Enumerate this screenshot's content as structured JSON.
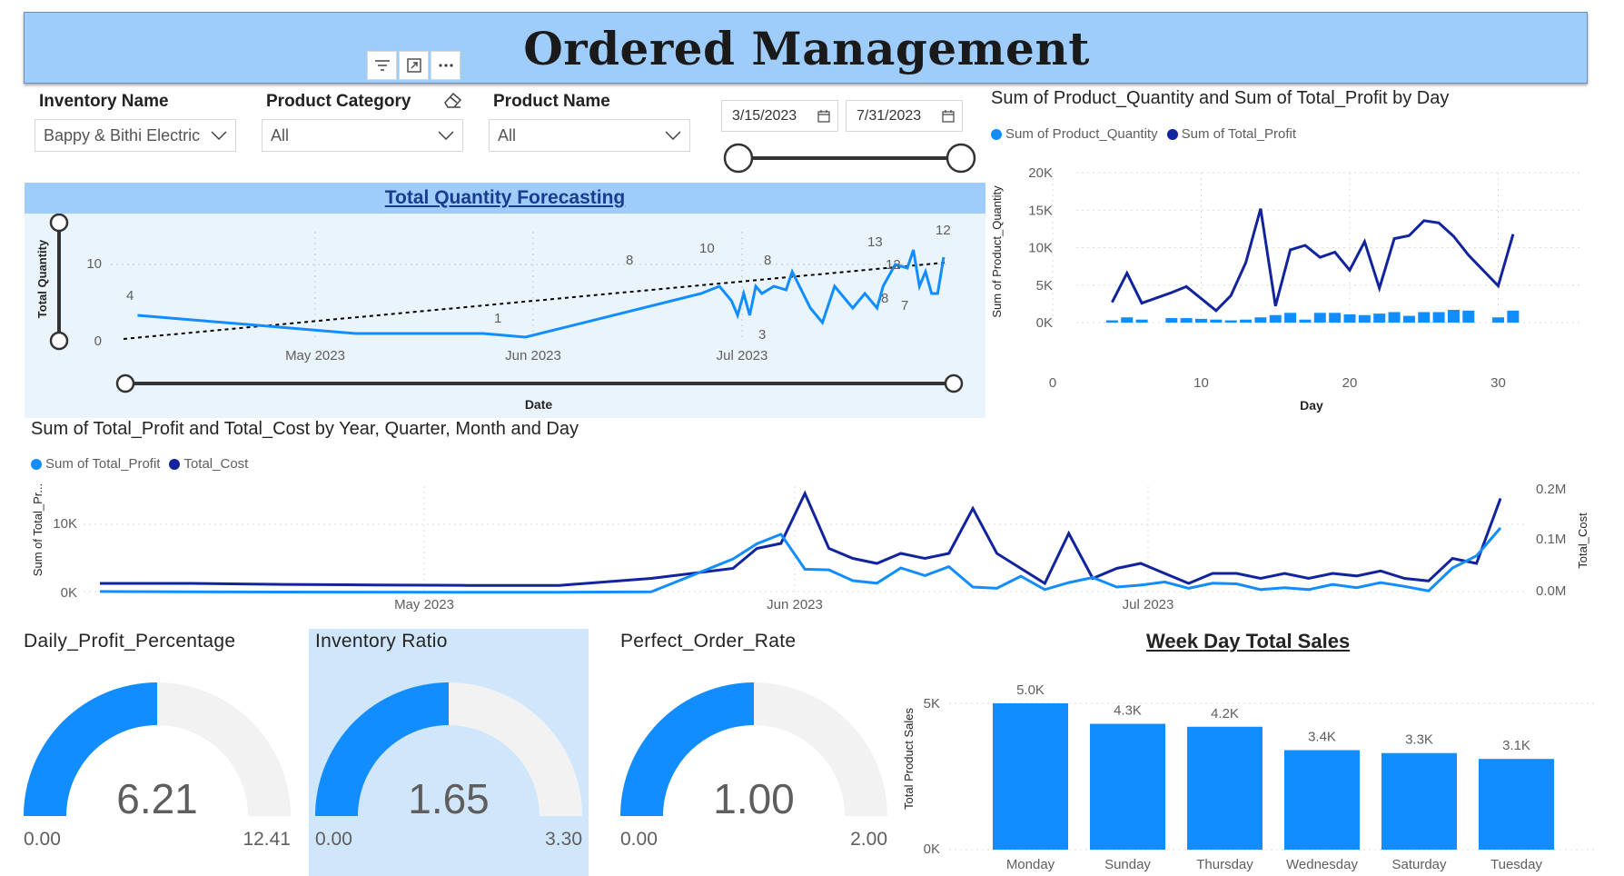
{
  "page_title": "Ordered Management",
  "header_icons": [
    "filter-icon",
    "focus-mode-icon",
    "more-options-icon"
  ],
  "slicers": {
    "inventory": {
      "label": "Inventory Name",
      "value": "Bappy & Bithi Electric"
    },
    "category": {
      "label": "Product Category",
      "value": "All"
    },
    "product": {
      "label": "Product Name",
      "value": "All"
    },
    "date_start": "3/15/2023",
    "date_end": "7/31/2023"
  },
  "forecast": {
    "title": "Total Quantity Forecasting",
    "ylabel": "Total Quantity",
    "xlabel": "Date",
    "yticks": [
      "10",
      "0"
    ],
    "xticks": [
      "May 2023",
      "Jun 2023",
      "Jul 2023"
    ],
    "labels": [
      "4",
      "1",
      "8",
      "10",
      "8",
      "3",
      "13",
      "12",
      "8",
      "7",
      "12"
    ]
  },
  "daily": {
    "title": "Sum of Product_Quantity and Sum of Total_Profit by Day",
    "legend": [
      "Sum of Product_Quantity",
      "Sum of Total_Profit"
    ],
    "ylabel": "Sum of Product_Quantity",
    "xlabel": "Day",
    "yticks": [
      "20K",
      "15K",
      "10K",
      "5K",
      "0K"
    ],
    "xticks": [
      "0",
      "10",
      "20",
      "30"
    ]
  },
  "profit_cost": {
    "title": "Sum of Total_Profit and Total_Cost by Year, Quarter, Month and Day",
    "legend": [
      "Sum of Total_Profit",
      "Total_Cost"
    ],
    "ylabel": "Sum of Total_Pr...",
    "ylabel2": "Total_Cost",
    "yticks": [
      "10K",
      "0K"
    ],
    "yticks2": [
      "0.2M",
      "0.1M",
      "0.0M"
    ],
    "xticks": [
      "May 2023",
      "Jun 2023",
      "Jul 2023"
    ]
  },
  "gauges": [
    {
      "title": "Daily_Profit_Percentage",
      "value": "6.21",
      "min": "0.00",
      "max": "12.41",
      "fraction": 0.5
    },
    {
      "title": "Inventory Ratio",
      "value": "1.65",
      "min": "0.00",
      "max": "3.30",
      "fraction": 0.5
    },
    {
      "title": "Perfect_Order_Rate",
      "value": "1.00",
      "min": "0.00",
      "max": "2.00",
      "fraction": 0.5
    }
  ],
  "weekday": {
    "title": "Week Day Total Sales",
    "ylabel": "Total Product Sales",
    "yticks": [
      "5K",
      "0K"
    ]
  },
  "colors": {
    "accent": "#118dff",
    "dark_series": "#12239e",
    "banner": "#9fcdfb",
    "selected_bg": "#cfe6fb",
    "gauge_bg": "#f2f2f2"
  },
  "chart_data": [
    {
      "type": "line",
      "title": "Total Quantity Forecasting",
      "xlabel": "Date",
      "ylabel": "Total Quantity",
      "x": [
        "2023-03-20",
        "2023-04-25",
        "2023-05-16",
        "2023-05-23",
        "2023-06-21",
        "2023-06-24",
        "2023-06-26",
        "2023-06-27",
        "2023-06-28",
        "2023-06-29",
        "2023-06-30",
        "2023-07-01",
        "2023-07-03",
        "2023-07-05",
        "2023-07-06",
        "2023-07-09",
        "2023-07-11",
        "2023-07-13",
        "2023-07-15",
        "2023-07-16",
        "2023-07-18",
        "2023-07-20",
        "2023-07-21",
        "2023-07-23",
        "2023-07-25",
        "2023-07-26",
        "2023-07-27",
        "2023-07-28",
        "2023-07-29",
        "2023-07-30",
        "2023-07-31"
      ],
      "series": [
        {
          "values": [
            4,
            1.5,
            1.5,
            1,
            7,
            8,
            6,
            4,
            7,
            4,
            8,
            7,
            8,
            7.5,
            10,
            5,
            3,
            8,
            6,
            5,
            7,
            5,
            8,
            11,
            10.5,
            13,
            8,
            10,
            7,
            7,
            12
          ]
        },
        {
          "values": [
            0,
            null,
            null,
            null,
            null,
            null,
            null,
            null,
            null,
            null,
            null,
            null,
            null,
            null,
            null,
            null,
            null,
            null,
            null,
            null,
            null,
            null,
            null,
            null,
            null,
            null,
            null,
            null,
            null,
            null,
            9.7
          ]
        }
      ],
      "ylim": [
        0,
        13
      ]
    },
    {
      "type": "bar",
      "title": "Sum of Product_Quantity and Sum of Total_Profit by Day",
      "xlabel": "Day",
      "ylabel": "Sum of Product_Quantity",
      "x": [
        4,
        5,
        6,
        8,
        9,
        10,
        11,
        12,
        13,
        14,
        15,
        16,
        17,
        18,
        19,
        20,
        21,
        22,
        23,
        24,
        25,
        26,
        27,
        28,
        30,
        31
      ],
      "series": [
        {
          "name": "Sum of Product_Quantity",
          "values": [
            300,
            700,
            400,
            600,
            600,
            500,
            400,
            300,
            400,
            700,
            1000,
            1300,
            400,
            1300,
            1300,
            1100,
            1000,
            1200,
            1400,
            900,
            1400,
            1400,
            1700,
            1600,
            700,
            1600
          ]
        },
        {
          "name": "Sum of Total_Profit",
          "values": [
            2700,
            6600,
            2600,
            4000,
            4800,
            3200,
            1600,
            3600,
            8000,
            15200,
            2200,
            9700,
            10300,
            8700,
            9400,
            7000,
            10800,
            4600,
            11200,
            11600,
            13600,
            13300,
            11500,
            9000,
            4900,
            11800
          ]
        }
      ],
      "ylim": [
        0,
        20000
      ],
      "xlim": [
        0,
        32
      ]
    },
    {
      "type": "line",
      "title": "Sum of Total_Profit and Total_Cost by Year, Quarter, Month and Day",
      "series": [
        {
          "name": "Sum of Total_Profit",
          "values": [
            300,
            260,
            220,
            200,
            180,
            180,
            250,
            5400,
            7800,
            9300,
            3800,
            3700,
            2000,
            1600,
            4000,
            2800,
            4200,
            1000,
            800,
            2700,
            600,
            1700,
            2500,
            1000,
            1300,
            1800,
            800,
            1600,
            1500,
            600,
            900,
            600,
            1400,
            900,
            1700,
            1100,
            400,
            4000,
            5900,
            10300
          ]
        },
        {
          "name": "Total_Cost",
          "values": [
            0.02,
            0.02,
            0.018,
            0.017,
            0.016,
            0.016,
            0.03,
            0.05,
            0.09,
            0.1,
            0.2,
            0.09,
            0.07,
            0.06,
            0.08,
            0.07,
            0.08,
            0.17,
            0.08,
            0.05,
            0.02,
            0.12,
            0.03,
            0.05,
            0.06,
            0.04,
            0.02,
            0.04,
            0.04,
            0.03,
            0.04,
            0.03,
            0.04,
            0.035,
            0.045,
            0.03,
            0.025,
            0.07,
            0.06,
            0.19
          ]
        }
      ],
      "ylim": [
        0,
        16000
      ],
      "ylim2": [
        0,
        0.2
      ]
    },
    {
      "type": "bar",
      "title": "Week Day Total Sales",
      "ylabel": "Total Product Sales",
      "categories": [
        "Monday",
        "Sunday",
        "Thursday",
        "Wednesday",
        "Saturday",
        "Tuesday"
      ],
      "values": [
        5000,
        4300,
        4200,
        3400,
        3300,
        3100
      ],
      "data_labels": [
        "5.0K",
        "4.3K",
        "4.2K",
        "3.4K",
        "3.3K",
        "3.1K"
      ],
      "ylim": [
        0,
        5000
      ]
    }
  ]
}
